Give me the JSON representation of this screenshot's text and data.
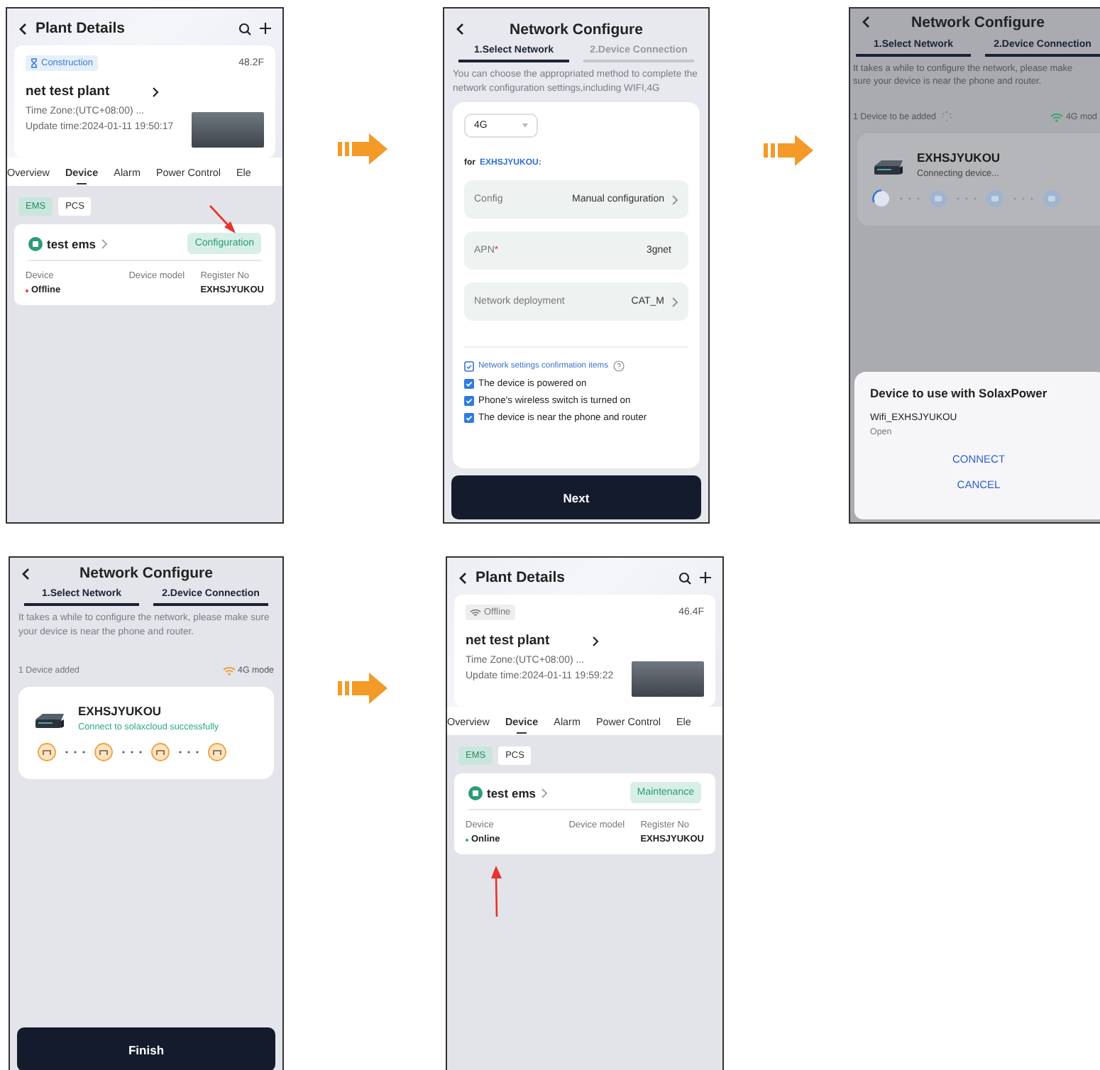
{
  "screens": [
    {
      "kind": "plant",
      "title": "Plant Details",
      "badge": {
        "kind": "construction",
        "text": "Construction"
      },
      "temperature": "48.2F",
      "plant_name": "net test plant",
      "time_zone": "Time Zone:(UTC+08:00) ...",
      "update_time": "Update time:2024-01-11 19:50:17",
      "tabs": [
        {
          "label": "Overview",
          "selected": false
        },
        {
          "label": "Device",
          "selected": true
        },
        {
          "label": "Alarm",
          "selected": false
        },
        {
          "label": "Power Control",
          "selected": false
        },
        {
          "label": "Ele",
          "selected": false
        }
      ],
      "device_types": [
        {
          "label": "EMS",
          "selected": true
        },
        {
          "label": "PCS",
          "selected": false
        }
      ],
      "device": {
        "name": "test ems",
        "action": "Configuration",
        "columns": [
          "Device",
          "Device model",
          "Register No"
        ],
        "status": "Offline",
        "online": false,
        "register_no": "EXHSJYUKOU"
      },
      "pointer": {
        "kind": "action"
      }
    },
    {
      "kind": "select_network",
      "title": "Network Configure",
      "steps": [
        {
          "label": "1.Select Network",
          "active": true
        },
        {
          "label": "2.Device Connection",
          "active": false
        }
      ],
      "intro": "You can choose the appropriated method to complete the network configuration settings,including WIFI,4G",
      "network_type": "4G",
      "for_label": "for",
      "device_id": "EXHSJYUKOU:",
      "settings": [
        {
          "label": "Config",
          "value": "Manual configuration",
          "chevron": true
        },
        {
          "label": "APN",
          "required_mark": "*",
          "value": "3gnet",
          "chevron": false
        },
        {
          "label": "Network deployment",
          "value": "CAT_M",
          "chevron": true
        }
      ],
      "confirm_title": "Network settings confirmation items",
      "checks": [
        {
          "label": "The device is powered on",
          "checked": true
        },
        {
          "label": "Phone's wireless switch is turned on",
          "checked": true
        },
        {
          "label": "The device is near the phone and router",
          "checked": true
        }
      ],
      "button": "Next"
    },
    {
      "kind": "connecting",
      "title": "Network Configure",
      "steps": [
        {
          "label": "1.Select Network",
          "active": true
        },
        {
          "label": "2.Device Connection",
          "active": true
        }
      ],
      "intro": "It takes a while to configure the network, please make sure your device is near the phone and router.",
      "count": "1 Device to be added",
      "mode": "4G mod",
      "device_name": "EXHSJYUKOU",
      "device_status": "Connecting device...",
      "progress": [
        {
          "kind": "active"
        },
        {
          "kind": "pending"
        },
        {
          "kind": "pending"
        },
        {
          "kind": "pending"
        }
      ],
      "dialog": {
        "title": "Device to use with SolaxPower",
        "network": "Wifi_EXHSJYUKOU",
        "security": "Open",
        "actions": [
          "CONNECT",
          "CANCEL"
        ]
      }
    },
    {
      "kind": "connected",
      "title": "Network Configure",
      "steps": [
        {
          "label": "1.Select Network",
          "active": true
        },
        {
          "label": "2.Device Connection",
          "active": true
        }
      ],
      "intro": "It takes a while to configure the network, please make sure your device is near the phone and router.",
      "count": "1 Device added",
      "mode": "4G mode",
      "device_name": "EXHSJYUKOU",
      "device_status": "Connect to solaxcloud successfully",
      "progress": [
        {
          "kind": "done"
        },
        {
          "kind": "done"
        },
        {
          "kind": "done"
        },
        {
          "kind": "done"
        }
      ],
      "button": "Finish"
    },
    {
      "kind": "plant",
      "title": "Plant Details",
      "badge": {
        "kind": "offline",
        "text": "Offline"
      },
      "temperature": "46.4F",
      "plant_name": "net test plant",
      "time_zone": "Time Zone:(UTC+08:00) ...",
      "update_time": "Update time:2024-01-11 19:59:22",
      "tabs": [
        {
          "label": "Overview",
          "selected": false
        },
        {
          "label": "Device",
          "selected": true
        },
        {
          "label": "Alarm",
          "selected": false
        },
        {
          "label": "Power Control",
          "selected": false
        },
        {
          "label": "Ele",
          "selected": false
        }
      ],
      "device_types": [
        {
          "label": "EMS",
          "selected": true
        },
        {
          "label": "PCS",
          "selected": false
        }
      ],
      "device": {
        "name": "test ems",
        "action": "Maintenance",
        "columns": [
          "Device",
          "Device model",
          "Register No"
        ],
        "status": "Online",
        "online": true,
        "register_no": "EXHSJYUKOU"
      },
      "pointer": {
        "kind": "status"
      }
    }
  ]
}
